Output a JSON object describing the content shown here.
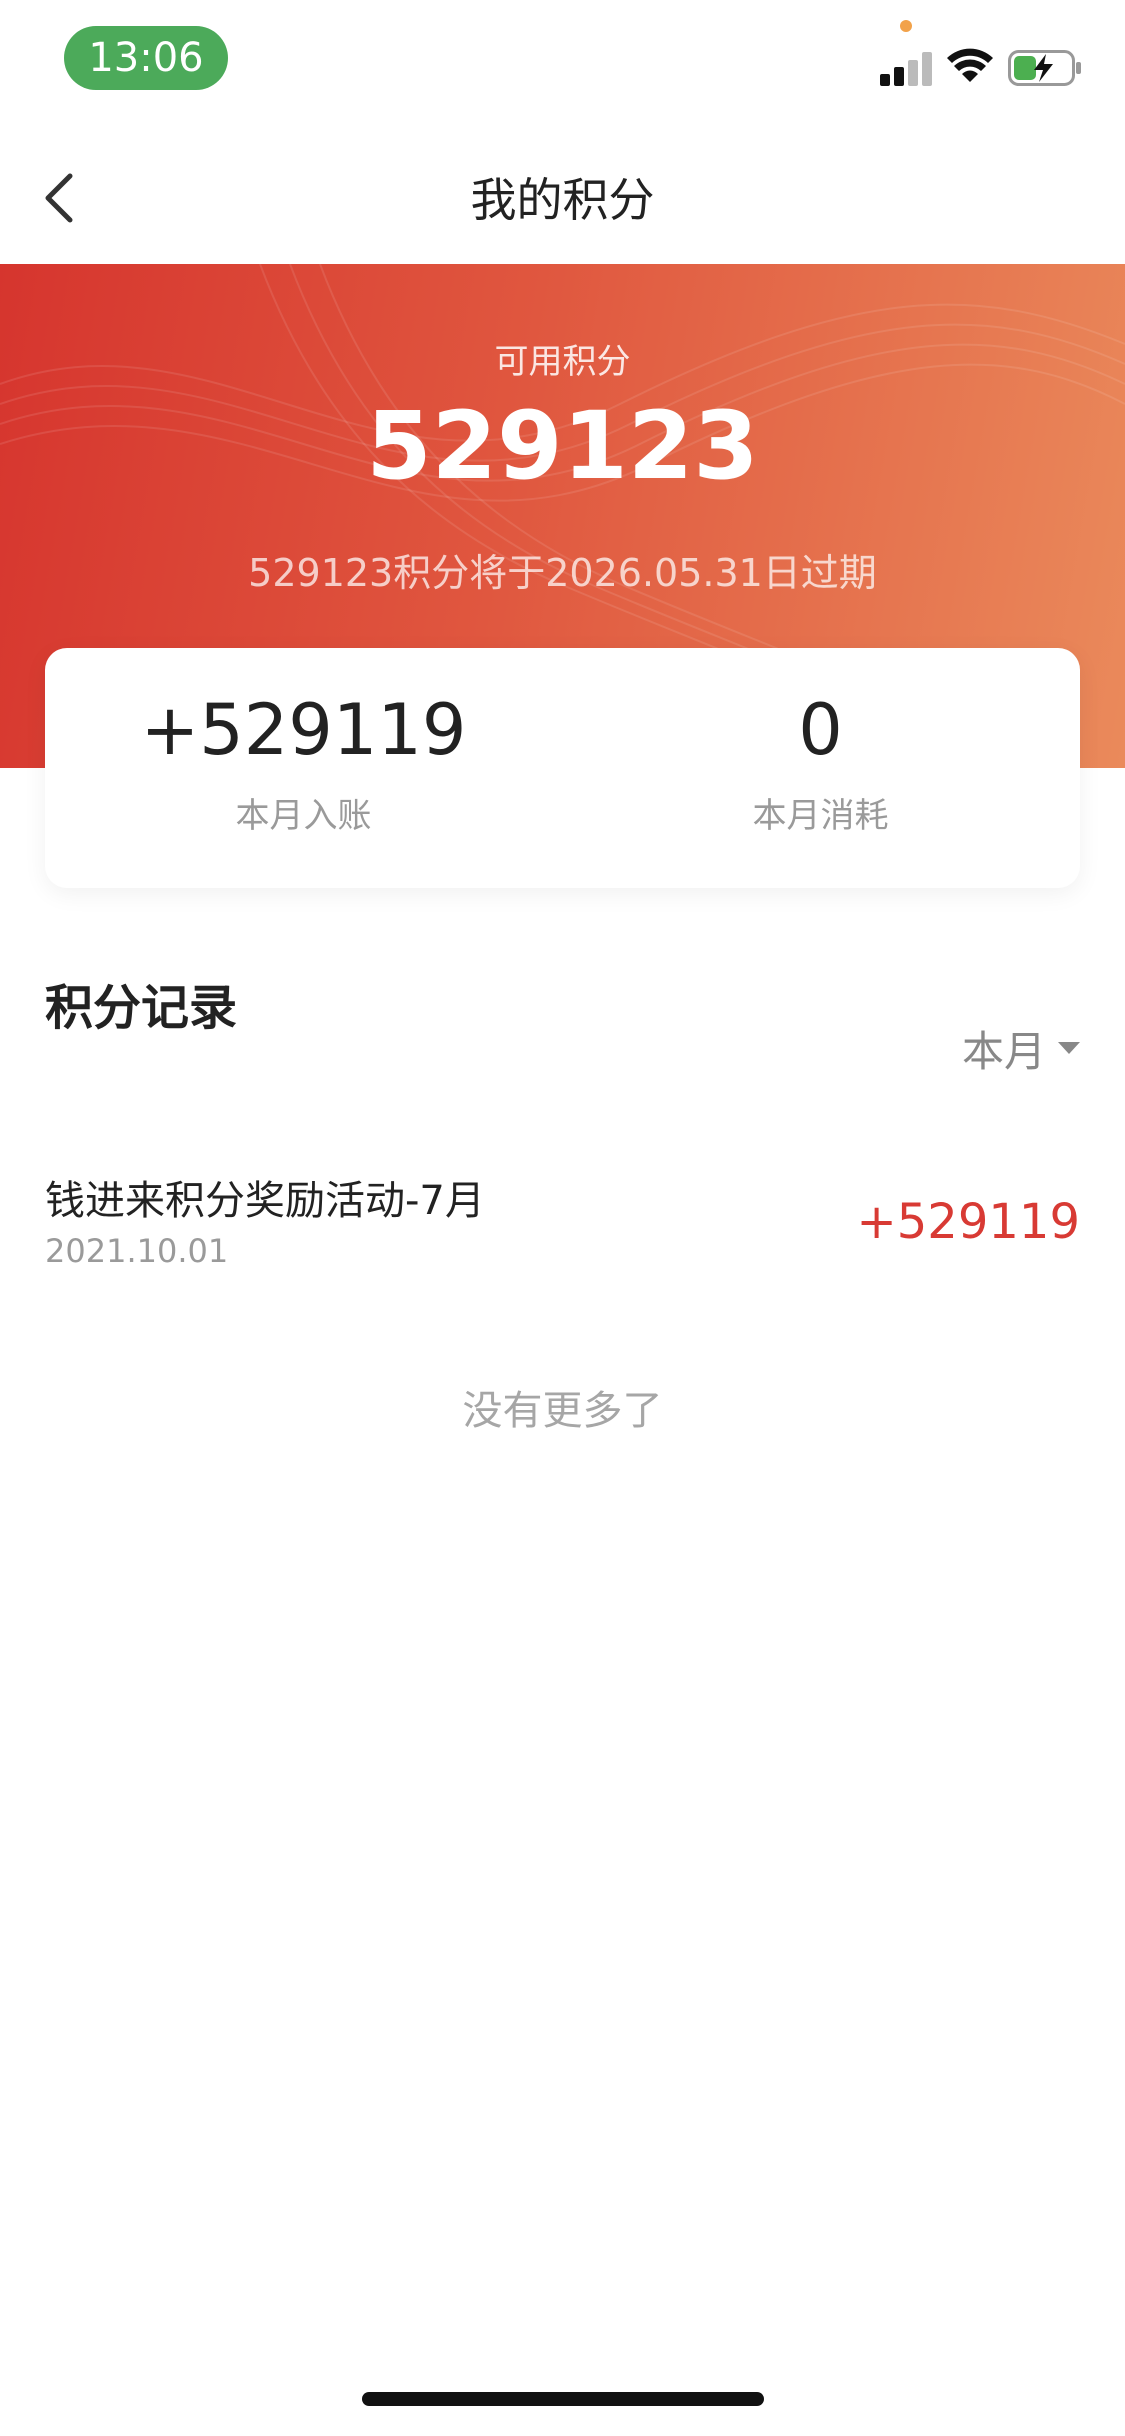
{
  "status_bar": {
    "time": "13:06"
  },
  "nav": {
    "title": "我的积分"
  },
  "hero": {
    "label": "可用积分",
    "value": "529123",
    "expire_note": "529123积分将于2026.05.31日过期"
  },
  "summary": {
    "income_value": "+529119",
    "income_label": "本月入账",
    "spend_value": "0",
    "spend_label": "本月消耗"
  },
  "records": {
    "title": "积分记录",
    "filter_label": "本月",
    "items": [
      {
        "title": "钱进来积分奖励活动-7月",
        "date": "2021.10.01",
        "amount": "+529119"
      }
    ],
    "end_text": "没有更多了"
  },
  "colors": {
    "accent": "#d83a34",
    "hero_start": "#d6352e",
    "hero_end": "#ea8a5b",
    "time_pill": "#4caa5a"
  }
}
